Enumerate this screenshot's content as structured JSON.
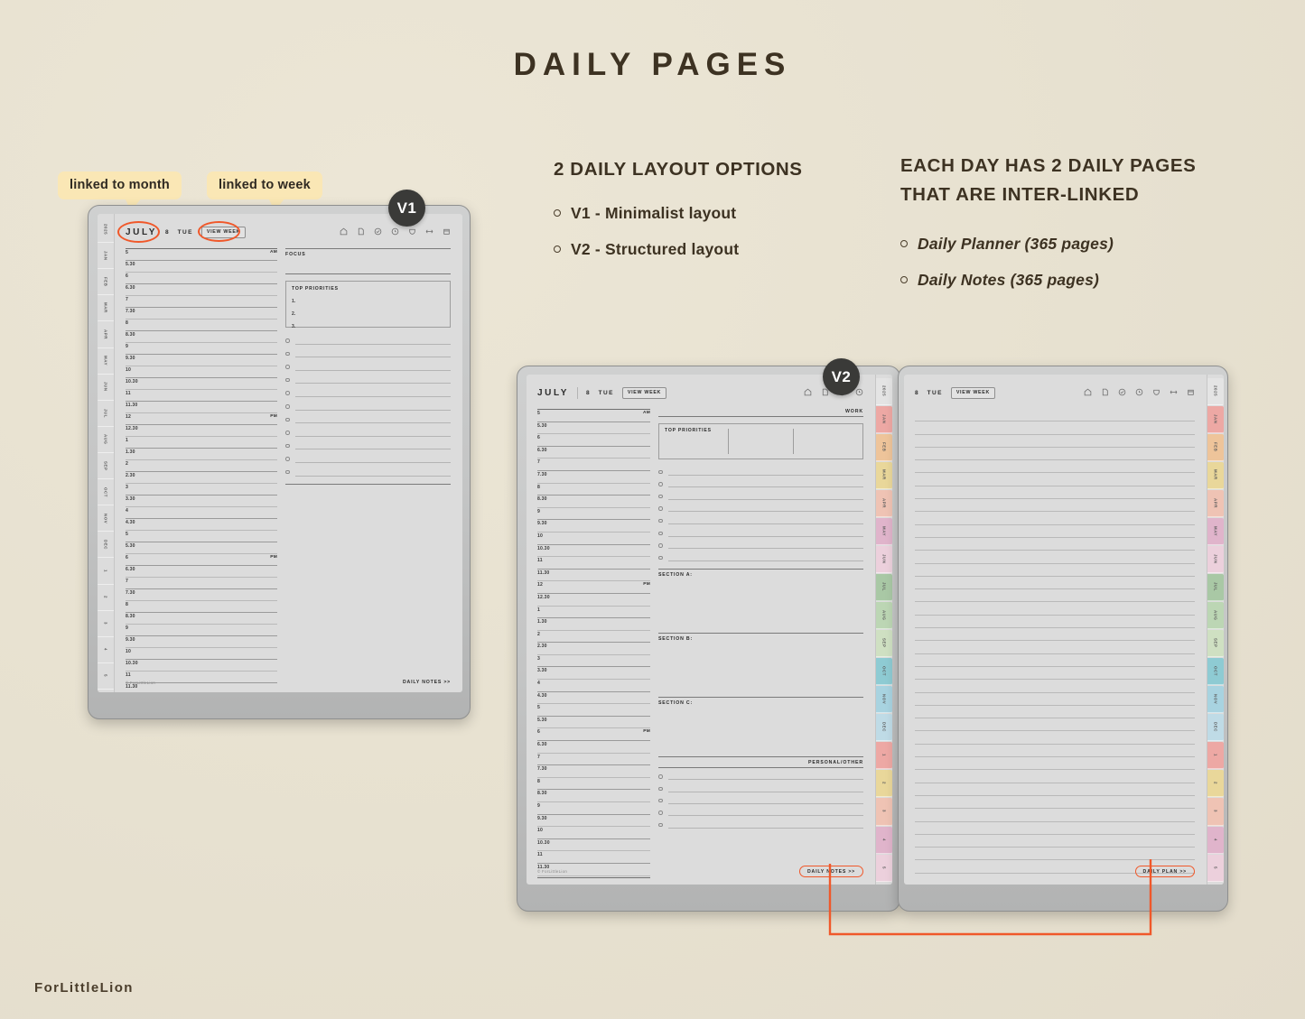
{
  "header": {
    "title": "DAILY PAGES"
  },
  "brand": {
    "name": "ForLittleLion"
  },
  "middle_column": {
    "heading": "2 DAILY LAYOUT OPTIONS",
    "bullets": [
      {
        "label": "V1 - Minimalist layout"
      },
      {
        "label": "V2 - Structured layout"
      }
    ]
  },
  "right_column": {
    "heading_line1": "EACH DAY HAS 2 DAILY PAGES",
    "heading_line2": "THAT ARE INTER-LINKED",
    "bullets": [
      {
        "label": "Daily Planner (365 pages)"
      },
      {
        "label": "Daily Notes (365 pages)"
      }
    ]
  },
  "callouts": [
    {
      "name": "linked-to-month",
      "label": "linked to month"
    },
    {
      "name": "linked-to-week",
      "label": "linked to week"
    }
  ],
  "badges": {
    "v1": "V1",
    "v2": "V2"
  },
  "planner_header": {
    "month": "JULY",
    "day_number": "8",
    "day_name": "TUE",
    "view_week": "VIEW WEEK",
    "icons": [
      "home-icon",
      "page-icon",
      "check-circle-icon",
      "clock-icon",
      "shield-icon",
      "arrows-icon",
      "calendar-icon"
    ]
  },
  "time_slots": [
    {
      "time": "5",
      "meridiem": "AM"
    },
    {
      "time": "5.30",
      "meridiem": ""
    },
    {
      "time": "6",
      "meridiem": ""
    },
    {
      "time": "6.30",
      "meridiem": ""
    },
    {
      "time": "7",
      "meridiem": ""
    },
    {
      "time": "7.30",
      "meridiem": ""
    },
    {
      "time": "8",
      "meridiem": ""
    },
    {
      "time": "8.30",
      "meridiem": ""
    },
    {
      "time": "9",
      "meridiem": ""
    },
    {
      "time": "9.30",
      "meridiem": ""
    },
    {
      "time": "10",
      "meridiem": ""
    },
    {
      "time": "10.30",
      "meridiem": ""
    },
    {
      "time": "11",
      "meridiem": ""
    },
    {
      "time": "11.30",
      "meridiem": ""
    },
    {
      "time": "12",
      "meridiem": "PM"
    },
    {
      "time": "12.30",
      "meridiem": ""
    },
    {
      "time": "1",
      "meridiem": ""
    },
    {
      "time": "1.30",
      "meridiem": ""
    },
    {
      "time": "2",
      "meridiem": ""
    },
    {
      "time": "2.30",
      "meridiem": ""
    },
    {
      "time": "3",
      "meridiem": ""
    },
    {
      "time": "3.30",
      "meridiem": ""
    },
    {
      "time": "4",
      "meridiem": ""
    },
    {
      "time": "4.30",
      "meridiem": ""
    },
    {
      "time": "5",
      "meridiem": ""
    },
    {
      "time": "5.30",
      "meridiem": ""
    },
    {
      "time": "6",
      "meridiem": "PM"
    },
    {
      "time": "6.30",
      "meridiem": ""
    },
    {
      "time": "7",
      "meridiem": ""
    },
    {
      "time": "7.30",
      "meridiem": ""
    },
    {
      "time": "8",
      "meridiem": ""
    },
    {
      "time": "8.30",
      "meridiem": ""
    },
    {
      "time": "9",
      "meridiem": ""
    },
    {
      "time": "9.30",
      "meridiem": ""
    },
    {
      "time": "10",
      "meridiem": ""
    },
    {
      "time": "10.30",
      "meridiem": ""
    },
    {
      "time": "11",
      "meridiem": ""
    },
    {
      "time": "11.30",
      "meridiem": ""
    }
  ],
  "v1_page": {
    "focus_label": "FOCUS",
    "top_priorities_label": "TOP PRIORITIES",
    "priority_numbers": [
      "1.",
      "2.",
      "3."
    ],
    "checkbox_count": 11,
    "copyright": "© ForLittleLion",
    "footer_link": "DAILY NOTES >>"
  },
  "v2_left_page": {
    "work_label": "WORK",
    "top_priorities_label": "TOP PRIORITIES",
    "checkbox_count": 8,
    "sections": [
      "SECTION A:",
      "SECTION B:",
      "SECTION C:"
    ],
    "personal_label": "PERSONAL/OTHER",
    "personal_checkbox_count": 5,
    "copyright": "© ForLittleLion",
    "footer_link": "DAILY NOTES >>"
  },
  "v2_right_page": {
    "day_number": "8",
    "day_name": "TUE",
    "view_week": "VIEW WEEK",
    "note_line_count": 36,
    "footer_link": "DAILY PLAN >>"
  },
  "side_tabs_plain": [
    {
      "label": "2025"
    },
    {
      "label": "JAN"
    },
    {
      "label": "FEB"
    },
    {
      "label": "MAR"
    },
    {
      "label": "APR"
    },
    {
      "label": "MAY"
    },
    {
      "label": "JUN"
    },
    {
      "label": "JUL"
    },
    {
      "label": "AUG"
    },
    {
      "label": "SEP"
    },
    {
      "label": "OCT"
    },
    {
      "label": "NOV"
    },
    {
      "label": "DEC"
    },
    {
      "label": "1"
    },
    {
      "label": "2"
    },
    {
      "label": "3"
    },
    {
      "label": "4"
    },
    {
      "label": "5"
    }
  ],
  "side_tabs_colored": [
    {
      "label": "2025",
      "color": "#e4e4e4"
    },
    {
      "label": "JAN",
      "color": "#eda8a4"
    },
    {
      "label": "FEB",
      "color": "#eec49a"
    },
    {
      "label": "MAR",
      "color": "#e9d79a"
    },
    {
      "label": "APR",
      "color": "#efc3b4"
    },
    {
      "label": "MAY",
      "color": "#e0b4cb"
    },
    {
      "label": "JUN",
      "color": "#ecd0dc"
    },
    {
      "label": "JUL",
      "color": "#a9c8a5"
    },
    {
      "label": "AUG",
      "color": "#bcd6b4"
    },
    {
      "label": "SEP",
      "color": "#cfe0c2"
    },
    {
      "label": "OCT",
      "color": "#8ecbd3"
    },
    {
      "label": "NOV",
      "color": "#a8d3e0"
    },
    {
      "label": "DEC",
      "color": "#bfdbe6"
    },
    {
      "label": "1",
      "color": "#eda8a4"
    },
    {
      "label": "2",
      "color": "#e9d79a"
    },
    {
      "label": "3",
      "color": "#efc3b4"
    },
    {
      "label": "4",
      "color": "#e0b4cb"
    },
    {
      "label": "5",
      "color": "#ecd0dc"
    }
  ],
  "colors": {
    "background": "#e8e2d1",
    "ink": "#3d3222",
    "accent_orange": "#f0582a",
    "callout_yellow": "#fae7b5",
    "badge_dark": "#3a3a38"
  }
}
